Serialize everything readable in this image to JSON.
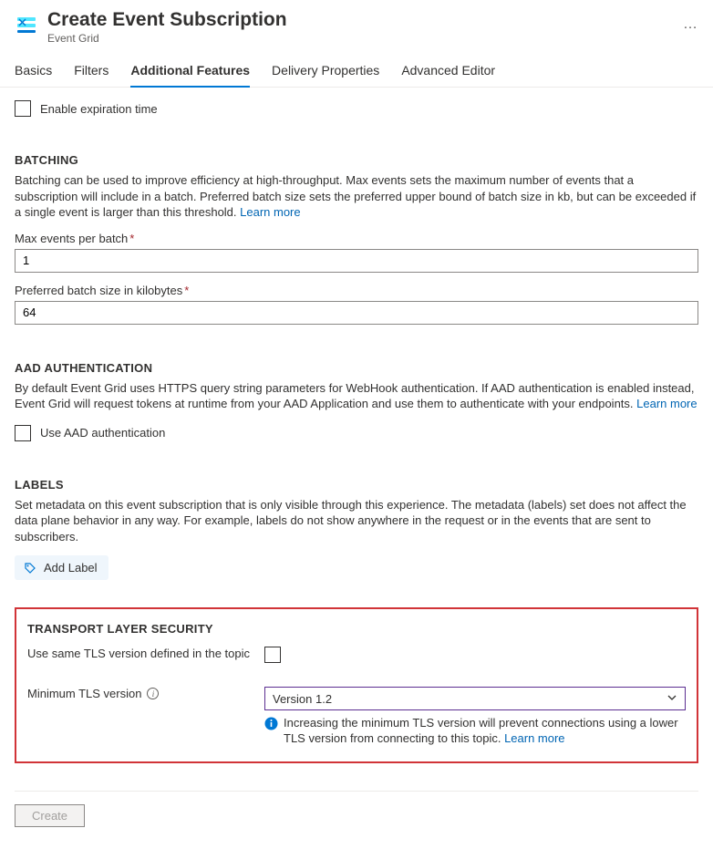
{
  "header": {
    "title": "Create Event Subscription",
    "subtitle": "Event Grid",
    "more": "…"
  },
  "tabs": {
    "basics": "Basics",
    "filters": "Filters",
    "additional": "Additional Features",
    "delivery": "Delivery Properties",
    "advanced": "Advanced Editor"
  },
  "expiration": {
    "label": "Enable expiration time"
  },
  "batching": {
    "title": "BATCHING",
    "desc": "Batching can be used to improve efficiency at high-throughput. Max events sets the maximum number of events that a subscription will include in a batch. Preferred batch size sets the preferred upper bound of batch size in kb, but can be exceeded if a single event is larger than this threshold. ",
    "learn": "Learn more",
    "max_label": "Max events per batch",
    "max_value": "1",
    "pref_label": "Preferred batch size in kilobytes",
    "pref_value": "64"
  },
  "aad": {
    "title": "AAD AUTHENTICATION",
    "desc": "By default Event Grid uses HTTPS query string parameters for WebHook authentication. If AAD authentication is enabled instead, Event Grid will request tokens at runtime from your AAD Application and use them to authenticate with your endpoints. ",
    "learn": "Learn more",
    "checkbox_label": "Use AAD authentication"
  },
  "labels": {
    "title": "LABELS",
    "desc": "Set metadata on this event subscription that is only visible through this experience. The metadata (labels) set does not affect the data plane behavior in any way. For example, labels do not show anywhere in the request or in the events that are sent to subscribers.",
    "add_button": "Add Label"
  },
  "tls": {
    "title": "TRANSPORT LAYER SECURITY",
    "same_label": "Use same TLS version defined in the topic",
    "min_label": "Minimum TLS version",
    "selected": "Version 1.2",
    "info": "Increasing the minimum TLS version will prevent connections using a lower TLS version from connecting to this topic. ",
    "learn": "Learn more"
  },
  "footer": {
    "create": "Create"
  }
}
